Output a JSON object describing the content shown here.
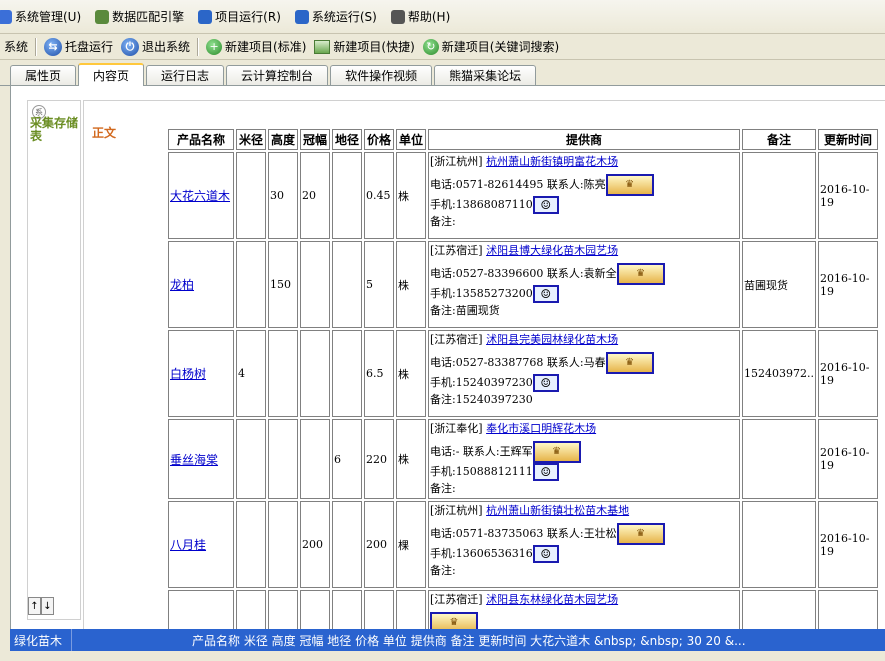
{
  "menu": [
    {
      "label": "系统管理(U)",
      "icon": "gear-icon"
    },
    {
      "label": "数据匹配引擎",
      "icon": "chart-icon"
    },
    {
      "label": "项目运行(R)",
      "icon": "globe-icon"
    },
    {
      "label": "系统运行(S)",
      "icon": "arrows-icon"
    },
    {
      "label": "帮助(H)",
      "icon": "list-icon"
    }
  ],
  "toolbar": {
    "system_label": "系统",
    "tray_label": "托盘运行",
    "exit_label": "退出系统",
    "new_std_label": "新建项目(标准)",
    "new_quick_label": "新建项目(快捷)",
    "new_kw_label": "新建项目(关键词搜索)"
  },
  "tabs": [
    "属性页",
    "内容页",
    "运行日志",
    "云计算控制台",
    "软件操作视频",
    "熊猫采集论坛"
  ],
  "active_tab": "内容页",
  "left_panel": {
    "badge": "系",
    "title": "采集存储表"
  },
  "body_label": "正文",
  "table": {
    "headers": [
      "产品名称",
      "米径",
      "高度",
      "冠幅",
      "地径",
      "价格",
      "单位",
      "提供商",
      "备注",
      "更新时间"
    ],
    "rows": [
      {
        "name": "大花六道木",
        "mijing": "",
        "height": "30",
        "crown": "20",
        "dijing": "",
        "price": "0.45",
        "unit": "株",
        "region": "[浙江杭州]",
        "company": "杭州萧山新街镇明富花木场",
        "phone": "电话:0571-82614495 联系人:陈亮",
        "mobile": "手机:13868087110",
        "note_line": "备注:",
        "remark": "",
        "date": "2016-10-19"
      },
      {
        "name": "龙柏",
        "mijing": "",
        "height": "150",
        "crown": "",
        "dijing": "",
        "price": "5",
        "unit": "株",
        "region": "[江苏宿迁]",
        "company": "沭阳县博大绿化苗木园艺场",
        "phone": "电话:0527-83396600 联系人:袁新全",
        "mobile": "手机:13585273200",
        "note_line": "备注:苗圃现货",
        "remark": "苗圃现货",
        "date": "2016-10-19"
      },
      {
        "name": "白杨树",
        "mijing": "4",
        "height": "",
        "crown": "",
        "dijing": "",
        "price": "6.5",
        "unit": "株",
        "region": "[江苏宿迁]",
        "company": "沭阳县完美园林绿化苗木场",
        "phone": "电话:0527-83387768 联系人:马春",
        "mobile": "手机:15240397230",
        "note_line": "备注:15240397230",
        "remark": "152403972..",
        "date": "2016-10-19"
      },
      {
        "name": "垂丝海棠",
        "mijing": "",
        "height": "",
        "crown": "",
        "dijing": "6",
        "price": "220",
        "unit": "株",
        "region": "[浙江奉化]",
        "company": "奉化市溪口明辉花木场",
        "phone": "电话:- 联系人:王辉军",
        "mobile": "手机:15088812111",
        "note_line": "备注:",
        "remark": "",
        "date": "2016-10-19"
      },
      {
        "name": "八月桂",
        "mijing": "",
        "height": "",
        "crown": "200",
        "dijing": "",
        "price": "200",
        "unit": "棵",
        "region": "[浙江杭州]",
        "company": "杭州萧山新街镇壮松苗木基地",
        "phone": "电话:0571-83735063 联系人:王壮松",
        "mobile": "手机:13606536316",
        "note_line": "备注:",
        "remark": "",
        "date": "2016-10-19"
      },
      {
        "name": "",
        "mijing": "",
        "height": "",
        "crown": "",
        "dijing": "",
        "price": "",
        "unit": "",
        "region": "[江苏宿迁]",
        "company": "沭阳县东林绿化苗木园艺场",
        "phone": "",
        "mobile": "",
        "note_line": "",
        "remark": "",
        "date": ""
      }
    ]
  },
  "statusbar": {
    "left": "绿化苗木",
    "right": "产品名称  米径  高度  冠幅  地径  价格  单位  提供商  备注  更新时间    大花六道木 &nbsp; &nbsp;  30  20  &..."
  }
}
